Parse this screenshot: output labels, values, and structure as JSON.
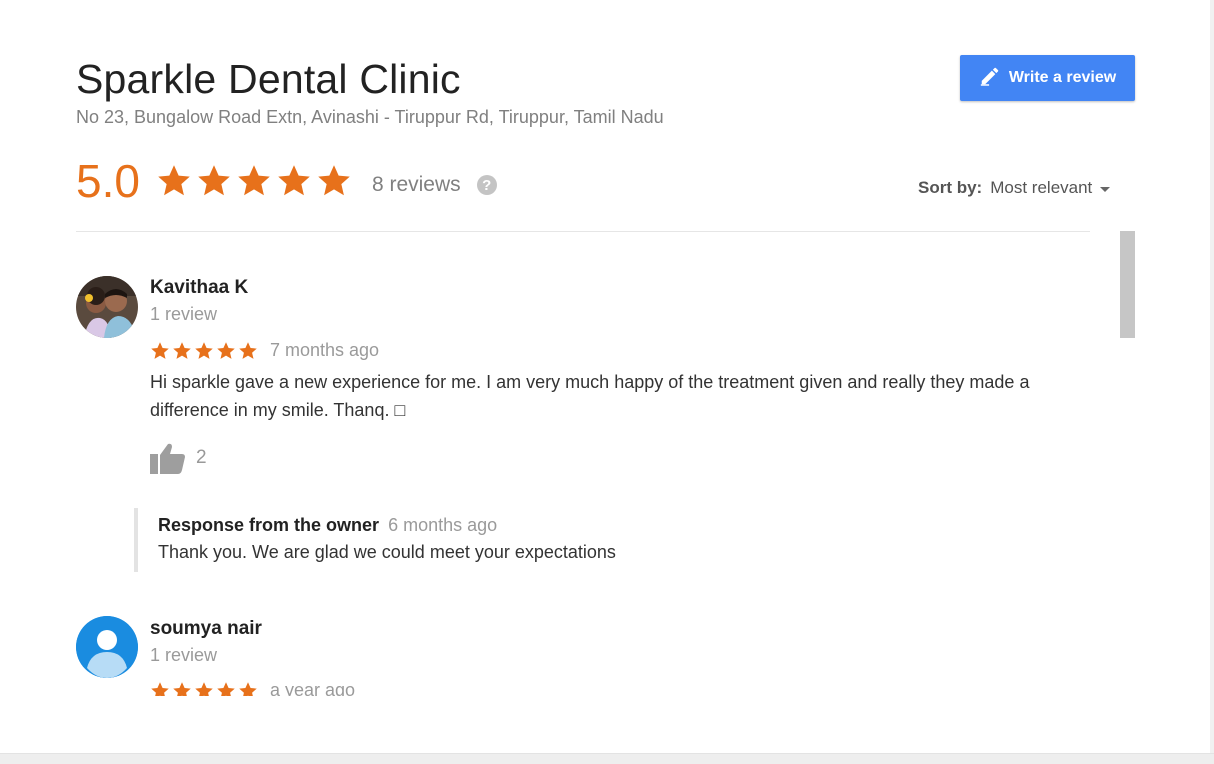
{
  "place": {
    "name": "Sparkle Dental Clinic",
    "address": "No 23, Bungalow Road Extn, Avinashi - Tiruppur Rd, Tiruppur, Tamil Nadu"
  },
  "write_review": {
    "label": "Write a review",
    "icon": "pencil-icon",
    "color": "#4285f4"
  },
  "rating": {
    "value": "5.0",
    "stars": 5,
    "count_text": "8 reviews",
    "help_icon": "?",
    "star_color": "#e7711b"
  },
  "sort": {
    "label": "Sort by:",
    "value": "Most relevant"
  },
  "reviews": [
    {
      "name": "Kavithaa K",
      "review_count": "1 review",
      "stars": 5,
      "time": "7 months ago",
      "text": "Hi sparkle gave a new experience for me. I am very much happy of the treatment given and really they made a difference in my smile. Thanq. □",
      "likes": "2",
      "avatar_icon": "user-photo",
      "owner_response": {
        "title": "Response from the owner",
        "time": "6 months ago",
        "text": "Thank you. We are glad we could meet your expectations"
      }
    },
    {
      "name": "soumya nair",
      "review_count": "1 review",
      "stars": 5,
      "time": "a year ago",
      "avatar_icon": "default-person-icon",
      "avatar_color": "#1a8ce0"
    }
  ]
}
